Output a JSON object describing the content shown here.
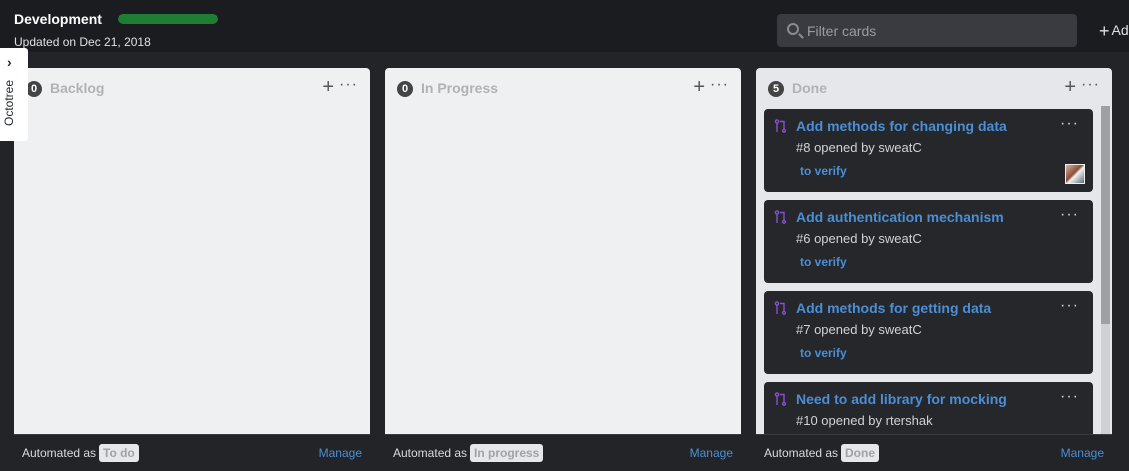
{
  "header": {
    "title": "Development",
    "progress_fraction": 1.0,
    "progress_color": "#1e7e34",
    "updated": "Updated on Dec 21, 2018",
    "filter_placeholder": "Filter cards",
    "add_label": "Ad"
  },
  "octotree": {
    "label": "Octotree",
    "icon": "chevron-right-icon"
  },
  "columns": [
    {
      "name": "Backlog",
      "count": "0",
      "automated_label": "Automated as",
      "automated_tag": "To do",
      "manage": "Manage",
      "cards": []
    },
    {
      "name": "In Progress",
      "count": "0",
      "automated_label": "Automated as",
      "automated_tag": "In progress",
      "manage": "Manage",
      "cards": []
    },
    {
      "name": "Done",
      "count": "5",
      "automated_label": "Automated as",
      "automated_tag": "Done",
      "manage": "Manage",
      "cards": [
        {
          "title": "Add methods for changing data",
          "meta": "#8 opened by sweatC",
          "label": "to verify",
          "icon": "pull-request-icon",
          "has_avatar": true
        },
        {
          "title": "Add authentication mechanism",
          "meta": "#6 opened by sweatC",
          "label": "to verify",
          "icon": "pull-request-icon",
          "has_avatar": false
        },
        {
          "title": "Add methods for getting data",
          "meta": "#7 opened by sweatC",
          "label": "to verify",
          "icon": "pull-request-icon",
          "has_avatar": false
        },
        {
          "title": "Need to add library for mocking",
          "meta": "#10 opened by rtershak",
          "label": "",
          "icon": "pull-request-icon",
          "has_avatar": false
        }
      ]
    }
  ],
  "colors": {
    "accent": "#4a8fd6",
    "pr_icon": "#8a4fd1"
  }
}
